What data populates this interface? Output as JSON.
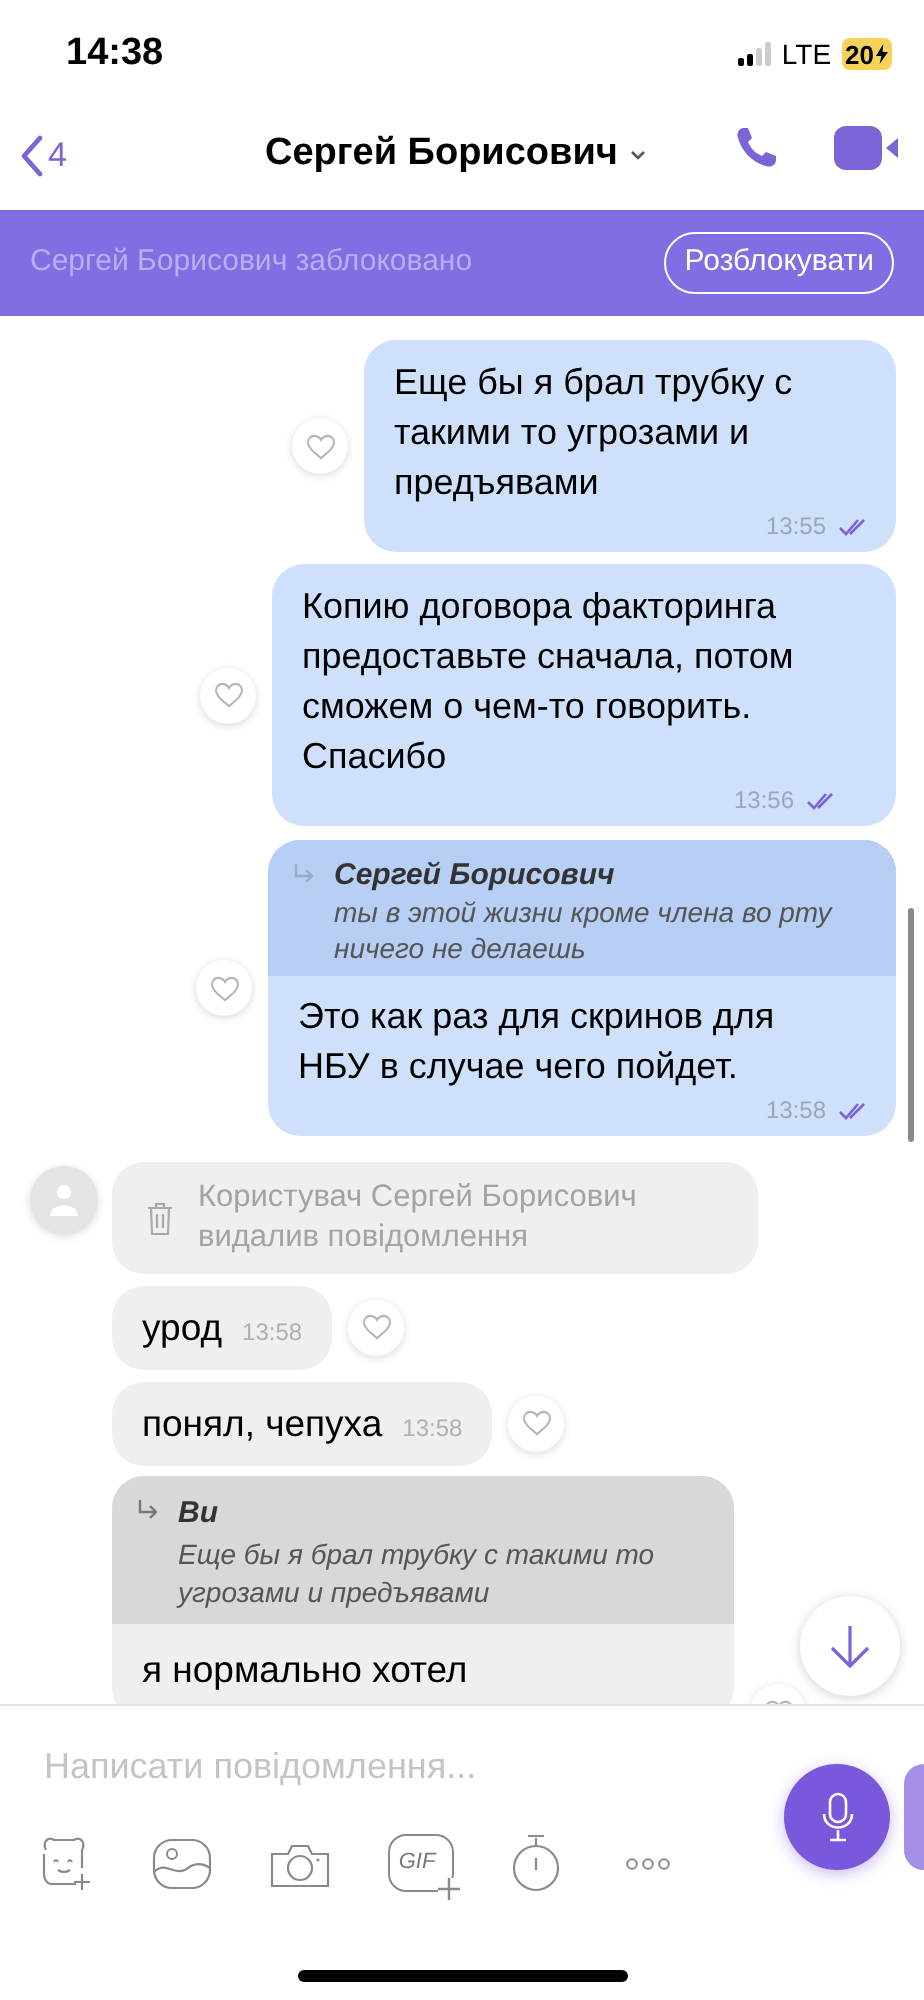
{
  "status_bar": {
    "time": "14:38",
    "network": "LTE",
    "battery": "20"
  },
  "header": {
    "back_count": "4",
    "title": "Сергей Борисович"
  },
  "blocked_banner": {
    "text": "Сергей Борисович заблоковано",
    "button": "Розблокувати"
  },
  "messages": [
    {
      "kind": "outgoing",
      "text": "Еще бы я брал трубку с такими то угрозами и предъявами",
      "time": "13:55",
      "read": true
    },
    {
      "kind": "outgoing",
      "text": "Копию договора факторинга предоставьте сначала, потом сможем о чем-то говорить. Спасибо",
      "time": "13:56",
      "read": true
    },
    {
      "kind": "outgoing",
      "quote": {
        "author": "Сергей Борисович",
        "text": "ты в этой жизни кроме члена во рту ничего не делаешь"
      },
      "text": "Это как раз для скринов для НБУ в случае чего пойдет.",
      "time": "13:58",
      "read": true
    },
    {
      "kind": "deleted",
      "text": "Користувач Сергей Борисович видалив повідомлення"
    },
    {
      "kind": "incoming",
      "text": "урод",
      "time": "13:58"
    },
    {
      "kind": "incoming",
      "text": "понял, чепуха",
      "time": "13:58"
    },
    {
      "kind": "incoming",
      "quote": {
        "author": "Ви",
        "text": "Еще бы я брал трубку с такими то угрозами и предъявами"
      },
      "text": "я нормально хотел"
    }
  ],
  "composer": {
    "placeholder": "Написати повідомлення...",
    "gif_label": "GIF"
  }
}
